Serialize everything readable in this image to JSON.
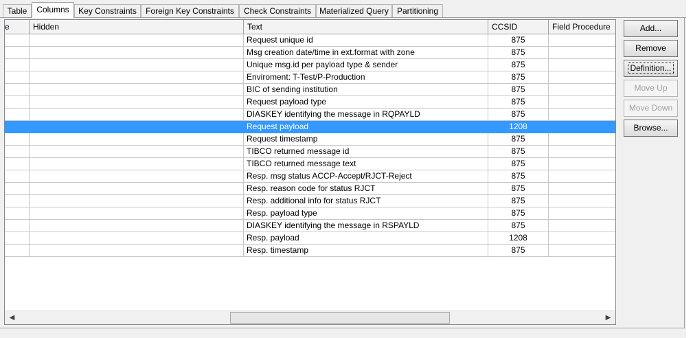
{
  "tabs": [
    {
      "label": "Table",
      "active": false
    },
    {
      "label": "Columns",
      "active": true
    },
    {
      "label": "Key Constraints",
      "active": false
    },
    {
      "label": "Foreign Key Constraints",
      "active": false
    },
    {
      "label": "Check Constraints",
      "active": false
    },
    {
      "label": "Materialized Query",
      "active": false
    },
    {
      "label": "Partitioning",
      "active": false
    }
  ],
  "grid": {
    "columns": [
      "e",
      "Hidden",
      "Text",
      "CCSID",
      "Field Procedure"
    ],
    "selected_row": 7,
    "rows": [
      {
        "text": "Request unique id",
        "ccsid": "875"
      },
      {
        "text": "Msg creation date/time in ext.format with zone",
        "ccsid": "875"
      },
      {
        "text": "Unique msg.id per payload type & sender",
        "ccsid": "875"
      },
      {
        "text": "Enviroment: T-Test/P-Production",
        "ccsid": "875"
      },
      {
        "text": "BIC of sending institution",
        "ccsid": "875"
      },
      {
        "text": "Request payload type",
        "ccsid": "875"
      },
      {
        "text": "DIASKEY identifying the message in RQPAYLD",
        "ccsid": "875"
      },
      {
        "text": "Request payload",
        "ccsid": "1208"
      },
      {
        "text": "Request timestamp",
        "ccsid": "875"
      },
      {
        "text": "TIBCO returned message id",
        "ccsid": "875"
      },
      {
        "text": "TIBCO returned message text",
        "ccsid": "875"
      },
      {
        "text": "Resp. msg status ACCP-Accept/RJCT-Reject",
        "ccsid": "875"
      },
      {
        "text": "Resp. reason code for status RJCT",
        "ccsid": "875"
      },
      {
        "text": "Resp. additional info for status RJCT",
        "ccsid": "875"
      },
      {
        "text": "Resp. payload type",
        "ccsid": "875"
      },
      {
        "text": "DIASKEY identifying the message in RSPAYLD",
        "ccsid": "875"
      },
      {
        "text": "Resp. payload",
        "ccsid": "1208"
      },
      {
        "text": "Resp. timestamp",
        "ccsid": "875"
      }
    ]
  },
  "buttons": {
    "add": "Add...",
    "remove": "Remove",
    "definition": "Definition...",
    "move_up": "Move Up",
    "move_down": "Move Down",
    "browse": "Browse..."
  },
  "scrollbar": {
    "left_arrow": "◀",
    "right_arrow": "▶"
  },
  "colors": {
    "selection": "#3399ff",
    "selection_text": "#ffffff"
  }
}
